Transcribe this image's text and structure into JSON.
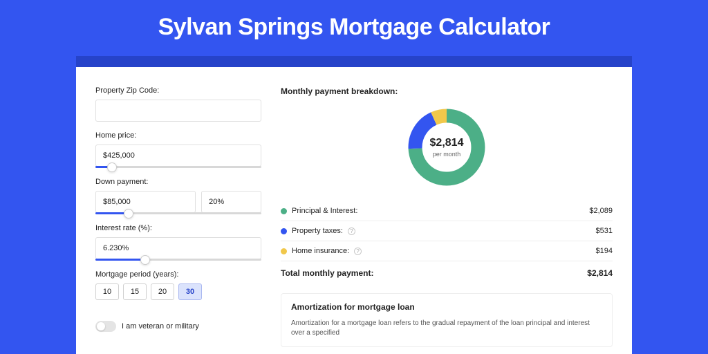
{
  "hero": {
    "title": "Sylvan Springs Mortgage Calculator"
  },
  "form": {
    "zip_label": "Property Zip Code:",
    "zip_value": "",
    "home_price_label": "Home price:",
    "home_price_value": "$425,000",
    "home_price_pct": 10,
    "down_label": "Down payment:",
    "down_value": "$85,000",
    "down_pct_value": "20%",
    "down_slider_pct": 20,
    "rate_label": "Interest rate (%):",
    "rate_value": "6.230%",
    "rate_slider_pct": 30,
    "period_label": "Mortgage period (years):",
    "periods": [
      "10",
      "15",
      "20",
      "30"
    ],
    "period_selected": "30",
    "veteran_label": "I am veteran or military"
  },
  "breakdown": {
    "title": "Monthly payment breakdown:",
    "center_amount": "$2,814",
    "center_sub": "per month",
    "items": [
      {
        "name": "Principal & Interest:",
        "value": "$2,089",
        "color": "#4caf87",
        "help": false
      },
      {
        "name": "Property taxes:",
        "value": "$531",
        "color": "#3355f0",
        "help": true
      },
      {
        "name": "Home insurance:",
        "value": "$194",
        "color": "#f1c84b",
        "help": true
      }
    ],
    "total_label": "Total monthly payment:",
    "total_value": "$2,814"
  },
  "amort": {
    "title": "Amortization for mortgage loan",
    "text": "Amortization for a mortgage loan refers to the gradual repayment of the loan principal and interest over a specified"
  },
  "chart_data": {
    "type": "pie",
    "title": "Monthly payment breakdown",
    "series": [
      {
        "name": "Principal & Interest",
        "value": 2089,
        "color": "#4caf87"
      },
      {
        "name": "Property taxes",
        "value": 531,
        "color": "#3355f0"
      },
      {
        "name": "Home insurance",
        "value": 194,
        "color": "#f1c84b"
      }
    ],
    "total": 2814,
    "unit": "USD per month"
  }
}
